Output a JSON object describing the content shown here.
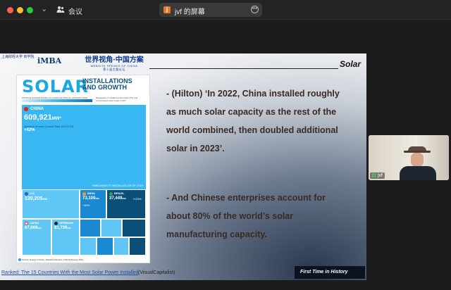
{
  "window": {
    "meeting_label": "会议",
    "share_title": "jvf 的屏幕",
    "share_badge": "j",
    "more_icon": "ellipsis-icon"
  },
  "slide": {
    "header": {
      "school_logo_text": "上海财经大学 商学院",
      "imba": "iMBA",
      "world_cn": "世界视角·中国方案",
      "world_en": "WEBSITE SPEAKS OF CHINA",
      "world_sub": "第十届主题论坛",
      "section_title": "Solar"
    },
    "infographic": {
      "title": "SOLAR",
      "subtitle": "INSTALLATIONS AND GROWTH",
      "range_label": "PROFILE SHADED BASED ON AVERAGE ANNUAL GROWTH RATE (2013-2023)",
      "note": "Megawatts of installed photovoltaic (PV) and concentrated solar power (CSP)",
      "china": {
        "name": "CHINA",
        "mw": "609,921",
        "unit": "MW*",
        "growth_label": "Average Annual Growth Rate (2013-23)",
        "growth": "+42%",
        "footnote": "*MEGAWATTS INSTALLED AS OF 2023"
      },
      "tiles": [
        {
          "name": "U.S.",
          "mw": "139,205",
          "unit": "MW",
          "growth": "",
          "color": "#5fc6f5",
          "flag": "#3c5aa8"
        },
        {
          "name": "INDIA",
          "mw": "73,109",
          "unit": "MW",
          "growth": "+40%",
          "color": "#1b89d1",
          "flag": "#f49a2a"
        },
        {
          "name": "BRAZIL",
          "mw": "37,449",
          "unit": "MW",
          "growth": "+123%",
          "color": "#0b4f79",
          "flag": "#2ca24a"
        },
        {
          "name": "JAPAN",
          "mw": "87,068",
          "unit": "MW",
          "growth": "",
          "color": "#5fc6f5",
          "flag": "#ffffff"
        },
        {
          "name": "GERMANY",
          "mw": "81,739",
          "unit": "MW",
          "growth": "",
          "color": "#5fc6f5",
          "flag": "#222222"
        }
      ],
      "source": "Source: Energy Institute, Statistical Review of World Energy 2024"
    },
    "bullets": [
      "- (Hilton) ‘In 2022, China installed roughly as much solar capacity as the rest of the world combined, then doubled additional solar in 2023’.",
      "- And Chinese enterprises account for about 80% of the world’s solar manufacturing capacity."
    ],
    "caption_link": "Ranked: The 15 Countries With the Most Solar Power Installed",
    "caption_rest": "(VisualCapitalist)",
    "badge": "First Time in History"
  },
  "participant": {
    "name": "jvf"
  }
}
